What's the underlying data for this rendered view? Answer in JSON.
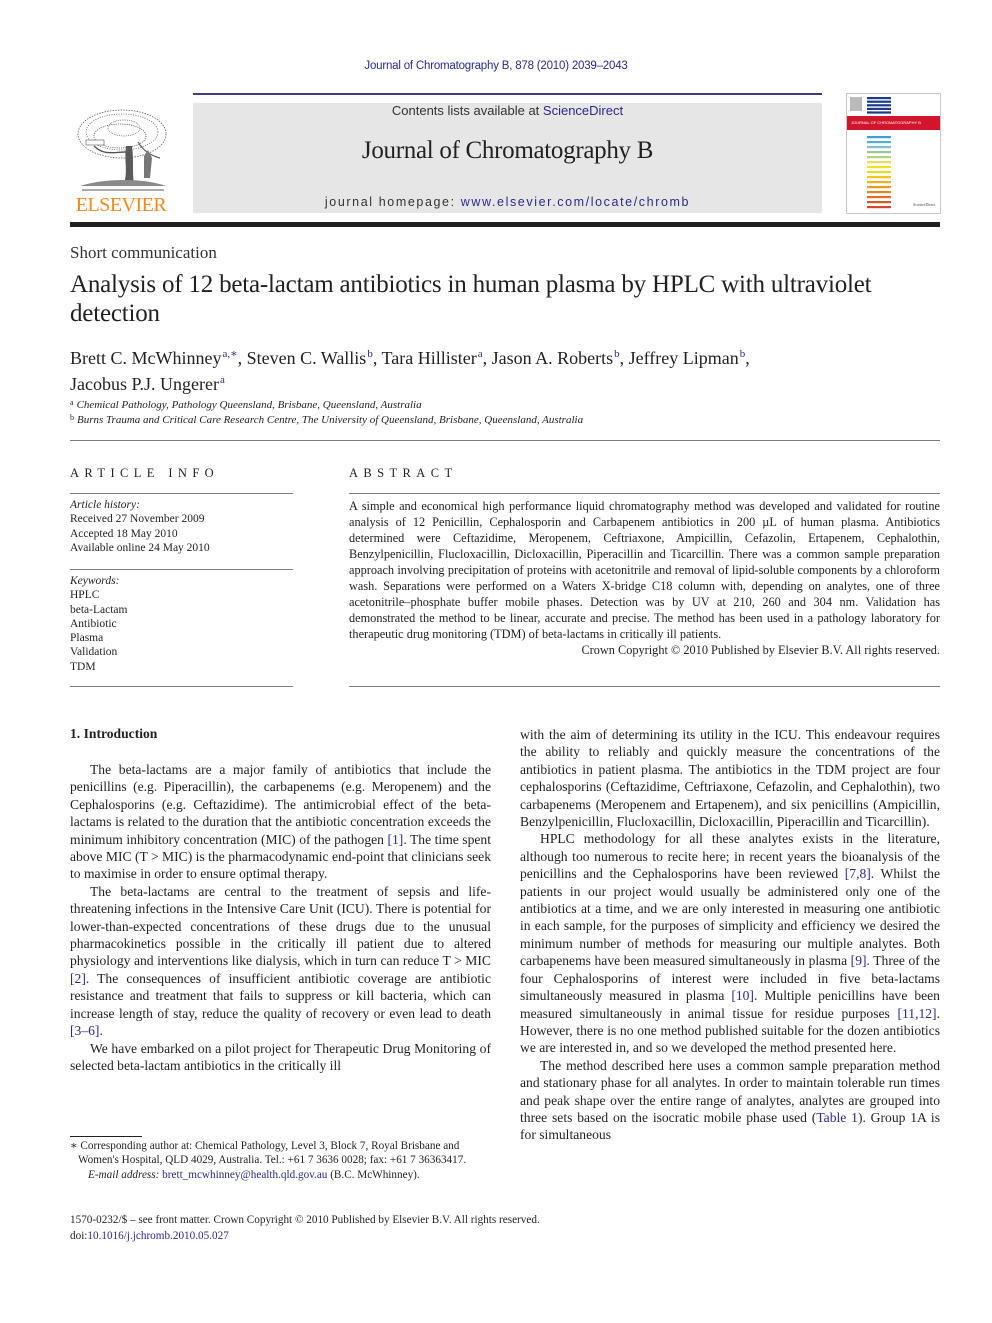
{
  "running_head": "Journal of Chromatography B, 878 (2010) 2039–2043",
  "masthead": {
    "publisher_logo_text": "ELSEVIER",
    "contents_prefix": "Contents lists available at ",
    "contents_link": "ScienceDirect",
    "journal_title": "Journal of Chromatography B",
    "homepage_prefix": "journal homepage: ",
    "homepage_url": "www.elsevier.com/locate/chromb",
    "brand_color": "#f08a1c",
    "link_color": "#2a2a8c",
    "masthead_bg": "#e6e6e7"
  },
  "cover": {
    "banner_text": "JOURNAL OF CHROMATOGRAPHY B",
    "banner_color": "#d2152c",
    "stripe_colors": [
      "#1c3a8c",
      "#1c3a8c",
      "#1c3a8c",
      "#1c3a8c",
      "#1c3a8c",
      "#3aa0d8",
      "#55aed6",
      "#7fc0cc",
      "#9cc59a",
      "#b7cf7a",
      "#e2e25a",
      "#f0e030",
      "#f4d820",
      "#f2c51c",
      "#eeb01c",
      "#e89a22",
      "#e38426",
      "#de6e2a",
      "#d6582c",
      "#cf4a2c"
    ]
  },
  "article": {
    "type": "Short communication",
    "title": "Analysis of 12 beta-lactam antibiotics in human plasma by HPLC with ultraviolet detection",
    "authors": [
      {
        "name": "Brett C. McWhinney",
        "aff": "a,∗",
        "sep": ", "
      },
      {
        "name": "Steven C. Wallis",
        "aff": "b",
        "sep": ", "
      },
      {
        "name": "Tara Hillister",
        "aff": "a",
        "sep": ", "
      },
      {
        "name": "Jason A. Roberts",
        "aff": "b",
        "sep": ", "
      },
      {
        "name": "Jeffrey Lipman",
        "aff": "b",
        "sep": ","
      },
      {
        "name": "Jacobus P.J. Ungerer",
        "aff": "a",
        "sep": ""
      }
    ],
    "affiliations": [
      {
        "key": "a",
        "text": "Chemical Pathology, Pathology Queensland, Brisbane, Queensland, Australia"
      },
      {
        "key": "b",
        "text": "Burns Trauma and Critical Care Research Centre, The University of Queensland, Brisbane, Queensland, Australia"
      }
    ]
  },
  "article_info": {
    "heading": "ARTICLE INFO",
    "history_label": "Article history:",
    "history": [
      "Received 27 November 2009",
      "Accepted 18 May 2010",
      "Available online 24 May 2010"
    ],
    "keywords_label": "Keywords:",
    "keywords": [
      "HPLC",
      "beta-Lactam",
      "Antibiotic",
      "Plasma",
      "Validation",
      "TDM"
    ]
  },
  "abstract": {
    "heading": "ABSTRACT",
    "text": "A simple and economical high performance liquid chromatography method was developed and validated for routine analysis of 12 Penicillin, Cephalosporin and Carbapenem antibiotics in 200 µL of human plasma. Antibiotics determined were Ceftazidime, Meropenem, Ceftriaxone, Ampicillin, Cefazolin, Ertapenem, Cephalothin, Benzylpenicillin, Flucloxacillin, Dicloxacillin, Piperacillin and Ticarcillin. There was a common sample preparation approach involving precipitation of proteins with acetonitrile and removal of lipid-soluble components by a chloroform wash. Separations were performed on a Waters X-bridge C18 column with, depending on analytes, one of three acetonitrile–phosphate buffer mobile phases. Detection was by UV at 210, 260 and 304 nm. Validation has demonstrated the method to be linear, accurate and precise. The method has been used in a pathology laboratory for therapeutic drug monitoring (TDM) of beta-lactams in critically ill patients.",
    "copyright": "Crown Copyright © 2010 Published by Elsevier B.V. All rights reserved."
  },
  "body": {
    "section_heading": "1.  Introduction",
    "left_paragraphs": [
      {
        "parts": [
          {
            "t": "The beta-lactams are a major family of antibiotics that include the penicillins (e.g. Piperacillin), the carbapenems (e.g. Meropenem) and the Cephalosporins (e.g. Ceftazidime). The antimicrobial effect of the beta-lactams is related to the duration that the antibiotic concentration exceeds the minimum inhibitory concentration (MIC) of the pathogen "
          },
          {
            "ref": "[1]"
          },
          {
            "t": ". The time spent above MIC (T > MIC) is the pharmacodynamic end-point that clinicians seek to maximise in order to ensure optimal therapy."
          }
        ]
      },
      {
        "parts": [
          {
            "t": "The beta-lactams are central to the treatment of sepsis and life-threatening infections in the Intensive Care Unit (ICU). There is potential for lower-than-expected concentrations of these drugs due to the unusual pharmacokinetics possible in the critically ill patient due to altered physiology and interventions like dialysis, which in turn can reduce T > MIC "
          },
          {
            "ref": "[2]"
          },
          {
            "t": ". The consequences of insufficient antibiotic coverage are antibiotic resistance and treatment that fails to suppress or kill bacteria, which can increase length of stay, reduce the quality of recovery or even lead to death "
          },
          {
            "ref": "[3–6]"
          },
          {
            "t": "."
          }
        ]
      },
      {
        "parts": [
          {
            "t": "We have embarked on a pilot project for Therapeutic Drug Monitoring of selected beta-lactam antibiotics in the critically ill"
          }
        ]
      }
    ],
    "right_paragraphs": [
      {
        "noindent": true,
        "parts": [
          {
            "t": "with the aim of determining its utility in the ICU. This endeavour requires the ability to reliably and quickly measure the concentrations of the antibiotics in patient plasma. The antibiotics in the TDM project are four cephalosporins (Ceftazidime, Ceftriaxone, Cefazolin, and Cephalothin), two carbapenems (Meropenem and Ertapenem), and six penicillins (Ampicillin, Benzylpenicillin, Flucloxacillin, Dicloxacillin, Piperacillin and Ticarcillin)."
          }
        ]
      },
      {
        "parts": [
          {
            "t": "HPLC methodology for all these analytes exists in the literature, although too numerous to recite here; in recent years the bioanalysis of the penicillins and the Cephalosporins have been reviewed "
          },
          {
            "ref": "[7,8]"
          },
          {
            "t": ". Whilst the patients in our project would usually be administered only one of the antibiotics at a time, and we are only interested in measuring one antibiotic in each sample, for the purposes of simplicity and efficiency we desired the minimum number of methods for measuring our multiple analytes. Both carbapenems have been measured simultaneously in plasma "
          },
          {
            "ref": "[9]"
          },
          {
            "t": ". Three of the four Cephalosporins of interest were included in five beta-lactams simultaneously measured in plasma "
          },
          {
            "ref": "[10]"
          },
          {
            "t": ". Multiple penicillins have been measured simultaneously in animal tissue for residue purposes "
          },
          {
            "ref": "[11,12]"
          },
          {
            "t": ". However, there is no one method published suitable for the dozen antibiotics we are interested in, and so we developed the method presented here."
          }
        ]
      },
      {
        "parts": [
          {
            "t": "The method described here uses a common sample preparation method and stationary phase for all analytes. In order to maintain tolerable run times and peak shape over the entire range of analytes, analytes are grouped into three sets based on the isocratic mobile phase used ("
          },
          {
            "ref": "Table 1"
          },
          {
            "t": "). Group 1A is for simultaneous"
          }
        ]
      }
    ]
  },
  "footnote": {
    "corresponding": "∗ Corresponding author at: Chemical Pathology, Level 3, Block 7, Royal Brisbane and Women's Hospital, QLD 4029, Australia. Tel.: +61 7 3636 0028; fax: +61 7 36363417.",
    "email_label": "E-mail address:",
    "email": "brett_mcwhinney@health.qld.gov.au",
    "email_suffix": " (B.C. McWhinney)."
  },
  "imprint": {
    "issn_line": "1570-0232/$ – see front matter. Crown Copyright © 2010 Published by Elsevier B.V. All rights reserved.",
    "doi_prefix": "doi:",
    "doi": "10.1016/j.jchromb.2010.05.027"
  }
}
